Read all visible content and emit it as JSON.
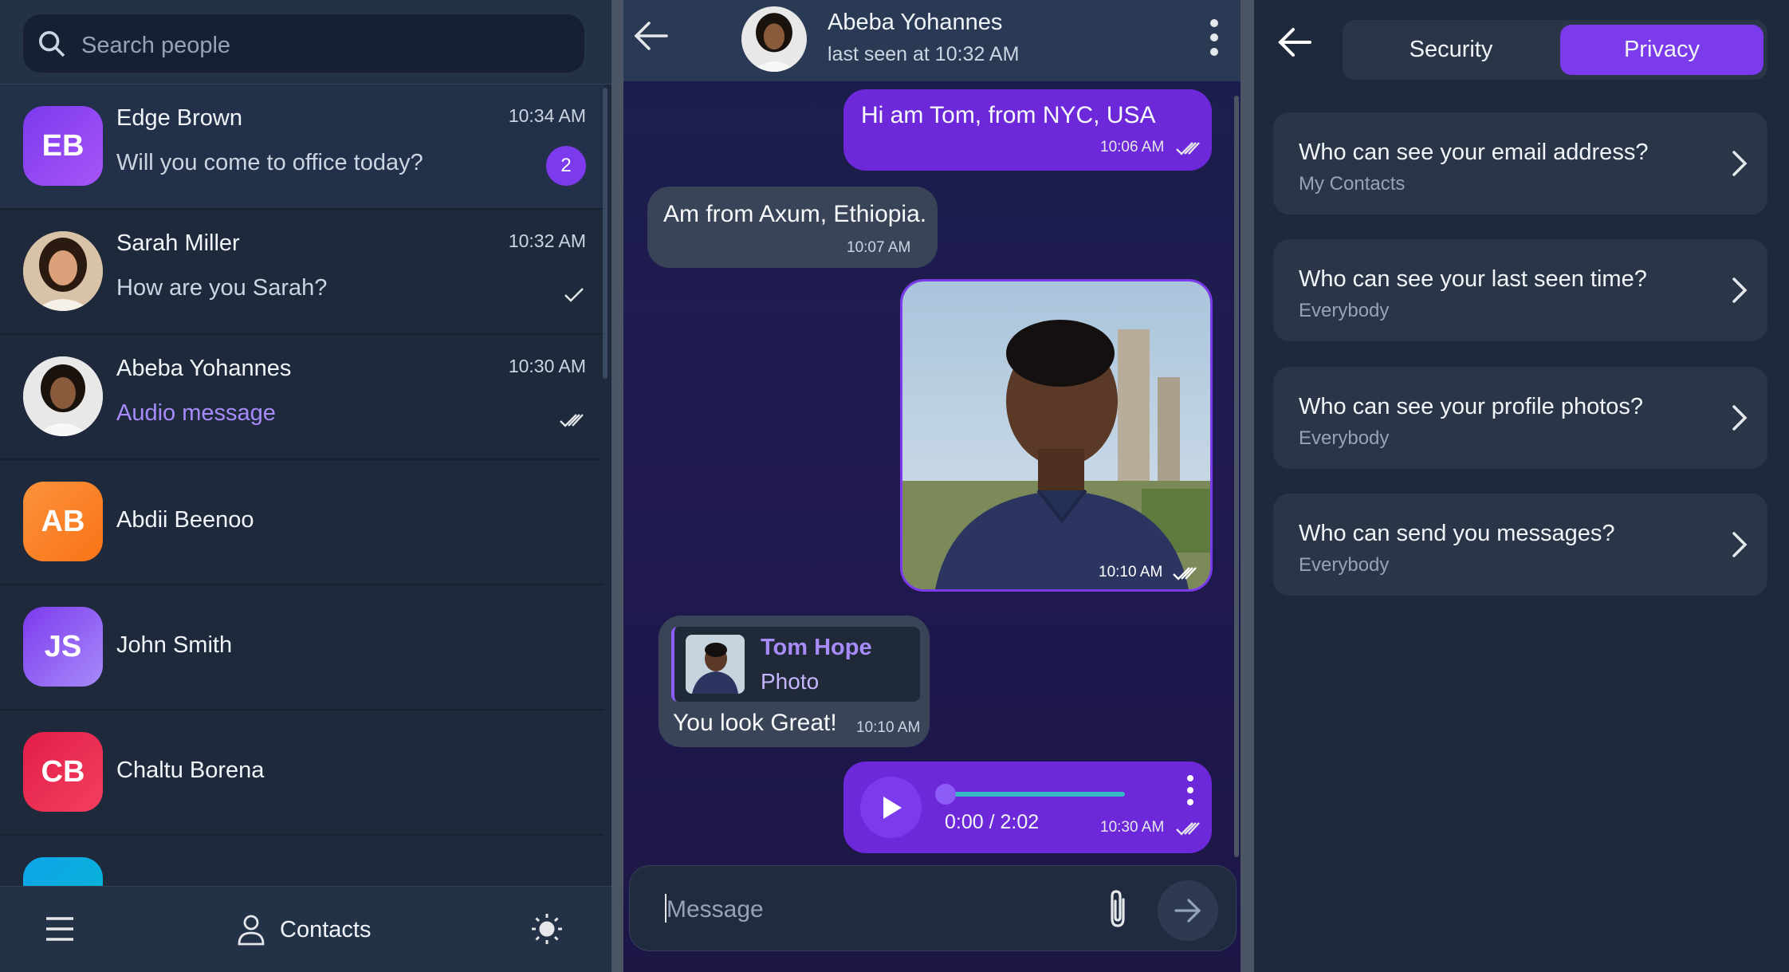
{
  "colors": {
    "accent": "#7c3aed",
    "accent_light": "#a78bfa",
    "panel_bg": "#1e293b",
    "bubble_in": "#3a4458"
  },
  "contacts_panel": {
    "search": {
      "placeholder": "Search people"
    },
    "chats": [
      {
        "initials": "EB",
        "name": "Edge Brown",
        "message": "Will you come to office today?",
        "time": "10:34 AM",
        "unread": "2",
        "color": "#7c3aed"
      },
      {
        "name": "Sarah Miller",
        "message": "How are you Sarah?",
        "time": "10:32 AM",
        "status_icon": "single-check-icon"
      },
      {
        "name": "Abeba Yohannes",
        "message": "Audio message",
        "time": "10:30 AM",
        "status_icon": "double-check-icon"
      },
      {
        "initials": "AB",
        "name": "Abdii Beenoo",
        "color": "#f97316"
      },
      {
        "initials": "JS",
        "name": "John Smith",
        "color": "#8b5cf6"
      },
      {
        "initials": "CB",
        "name": "Chaltu Borena",
        "color": "#e11d48"
      }
    ],
    "footer": {
      "contacts_label": "Contacts"
    }
  },
  "chat_panel": {
    "header": {
      "name": "Abeba Yohannes",
      "status": "last seen at 10:32 AM"
    },
    "messages": [
      {
        "direction": "out",
        "text": "Hi am Tom, from NYC, USA",
        "time": "10:06 AM"
      },
      {
        "direction": "in",
        "text": "Am from Axum, Ethiopia.",
        "time": "10:07 AM"
      },
      {
        "direction": "out",
        "type": "photo",
        "time": "10:10 AM"
      },
      {
        "direction": "in",
        "type": "reply",
        "reply_to": "Tom Hope",
        "reply_kind": "Photo",
        "text": "You look Great!",
        "time": "10:10 AM"
      },
      {
        "direction": "out",
        "type": "audio",
        "duration": "0:00 / 2:02",
        "progress": 0,
        "time": "10:30 AM"
      }
    ],
    "composer": {
      "placeholder": "Message"
    }
  },
  "settings_panel": {
    "tabs": [
      {
        "label": "Security"
      },
      {
        "label": "Privacy",
        "active": true
      }
    ],
    "items": [
      {
        "question": "Who can see your email address?",
        "value": "My Contacts"
      },
      {
        "question": "Who can see your last seen time?",
        "value": "Everybody"
      },
      {
        "question": "Who can see your profile photos?",
        "value": "Everybody"
      },
      {
        "question": "Who can send you messages?",
        "value": "Everybody"
      }
    ]
  }
}
